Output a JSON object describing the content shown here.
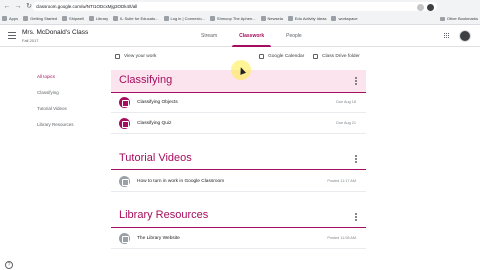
{
  "browser": {
    "url": "classroom.google.com/w/NTI1ODcxMjg3ODk4/t/all",
    "back_icon": "arrow-left-icon",
    "forward_icon": "arrow-right-icon",
    "reload_icon": "reload-icon",
    "bookmarks": [
      {
        "label": "Apps"
      },
      {
        "label": "Getting Started"
      },
      {
        "label": "Shipwell"
      },
      {
        "label": "Library"
      },
      {
        "label": "IL Suite for Educato..."
      },
      {
        "label": "Log in | Connexio..."
      },
      {
        "label": "Shmoop The Aphen..."
      },
      {
        "label": "Newsela"
      },
      {
        "label": "Edu Activity Ideas"
      },
      {
        "label": "workspace"
      }
    ],
    "other_bookmarks": "Other Bookmarks"
  },
  "header": {
    "class_name": "Mrs. McDonald's Class",
    "class_section": "Fall 2017",
    "tabs": [
      {
        "label": "Stream"
      },
      {
        "label": "Classwork"
      },
      {
        "label": "People"
      }
    ],
    "active_tab": "Classwork"
  },
  "sidebar": {
    "items": [
      {
        "label": "All topics"
      },
      {
        "label": "Classifying"
      },
      {
        "label": "Tutorial Videos"
      },
      {
        "label": "Library Resources"
      }
    ]
  },
  "toolbar": {
    "view_work": "View your work",
    "calendar": "Google Calendar",
    "drive": "Class Drive folder"
  },
  "sections": [
    {
      "title": "Classifying",
      "items": [
        {
          "title": "Classifying Objects",
          "date": "Due Aug 18",
          "type": "assignment"
        },
        {
          "title": "Classifying Quiz",
          "date": "Due Aug 21",
          "type": "assignment"
        }
      ]
    },
    {
      "title": "Tutorial Videos",
      "items": [
        {
          "title": "How to turn in work in Google Classroom",
          "date": "Posted 11:17 AM",
          "type": "material"
        }
      ]
    },
    {
      "title": "Library Resources",
      "items": [
        {
          "title": "The Library Website",
          "date": "Posted 11:08 AM",
          "type": "material"
        }
      ]
    }
  ],
  "colors": {
    "accent": "#a50e5e",
    "accent_band": "#fce4ef"
  }
}
